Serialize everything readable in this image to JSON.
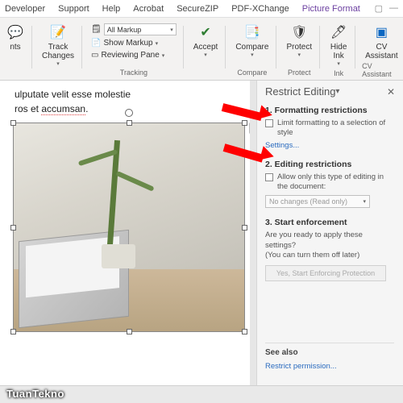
{
  "menu": {
    "items": [
      "Developer",
      "Support",
      "Help",
      "Acrobat",
      "SecureZIP",
      "PDF-XChange"
    ],
    "contextTab": "Picture Format"
  },
  "ribbon": {
    "comments": {
      "label": "nts"
    },
    "track": {
      "label": "Track\nChanges"
    },
    "markup": {
      "option1": "All Markup",
      "option2": "Show Markup",
      "option3": "Reviewing Pane",
      "group": "Tracking"
    },
    "accept": {
      "label": "Accept"
    },
    "compare": {
      "label": "Compare",
      "group": "Compare"
    },
    "protect": {
      "label": "Protect",
      "group": "Protect"
    },
    "hideink": {
      "label": "Hide\nInk",
      "group": "Ink"
    },
    "cv": {
      "label": "CV\nAssistant",
      "group": "CV Assistant"
    }
  },
  "doc": {
    "line1": "ulputate velit esse molestie",
    "line2a": "ros et ",
    "line2b": "accumsan",
    "line2c": "."
  },
  "restrict": {
    "title": "Restrict Editing",
    "s1": {
      "title": "1. Formatting restrictions",
      "chk": "Limit formatting to a selection of style",
      "settings": "Settings..."
    },
    "s2": {
      "title": "2. Editing restrictions",
      "chk": "Allow only this type of editing in the document:",
      "dd": "No changes (Read only)"
    },
    "s3": {
      "title": "3. Start enforcement",
      "q1": "Are you ready to apply these settings?",
      "q2": "(You can turn them off later)",
      "btn": "Yes, Start Enforcing Protection"
    },
    "seealso": {
      "title": "See also",
      "link": "Restrict permission..."
    }
  },
  "watermark": "TuanTekno"
}
